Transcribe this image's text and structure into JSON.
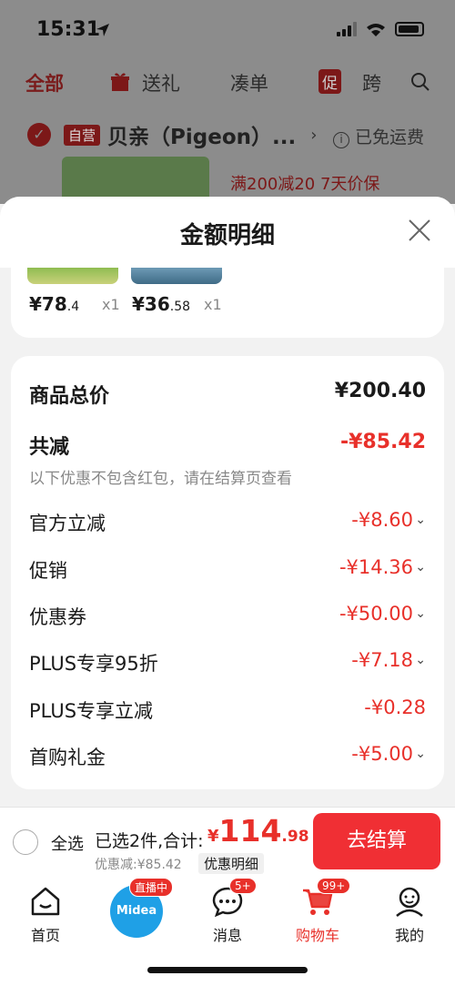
{
  "status_bar": {
    "time": "15:31"
  },
  "background": {
    "tabs": [
      "全部",
      "送礼",
      "凑单",
      "跨"
    ],
    "promo_badge": "促",
    "shop": {
      "self_operated_badge": "自营",
      "name": "贝亲（Pigeon）...",
      "free_shipping": "已免运费"
    },
    "promo_text": "满200减20  7天价保"
  },
  "sheet": {
    "title": "金额明细",
    "items": [
      {
        "price_int": "¥78",
        "price_dec": ".4",
        "qty": "x1"
      },
      {
        "price_int": "¥36",
        "price_dec": ".58",
        "qty": "x1"
      }
    ],
    "rows": {
      "total_label": "商品总价",
      "total_value": "¥200.40",
      "reduce_label": "共减",
      "reduce_value": "-¥85.42",
      "note": "以下优惠不包含红包，请在结算页查看",
      "official_label": "官方立减",
      "official_value": "-¥8.60",
      "promo_label": "促销",
      "promo_value": "-¥14.36",
      "coupon_label": "优惠券",
      "coupon_value": "-¥50.00",
      "plus95_label": "PLUS专享95折",
      "plus95_value": "-¥7.18",
      "plusreduce_label": "PLUS专享立减",
      "plusreduce_value": "-¥0.28",
      "firstbuy_label": "首购礼金",
      "firstbuy_value": "-¥5.00"
    }
  },
  "checkout": {
    "select_all": "全选",
    "selected_text": "已选2件,合计:",
    "total_currency": "¥",
    "total_int": "114",
    "total_dec": ".98",
    "discount_text": "优惠减:¥85.42",
    "detail_link": "优惠明细",
    "button": "去结算"
  },
  "nav": {
    "home": "首页",
    "live_badge": "直播中",
    "live_brand": "Midea",
    "messages": "消息",
    "messages_badge": "5+",
    "cart": "购物车",
    "cart_badge": "99+",
    "mine": "我的"
  },
  "colors": {
    "accent": "#e8302a",
    "button": "#f02f34",
    "live": "#1fa0e6"
  }
}
